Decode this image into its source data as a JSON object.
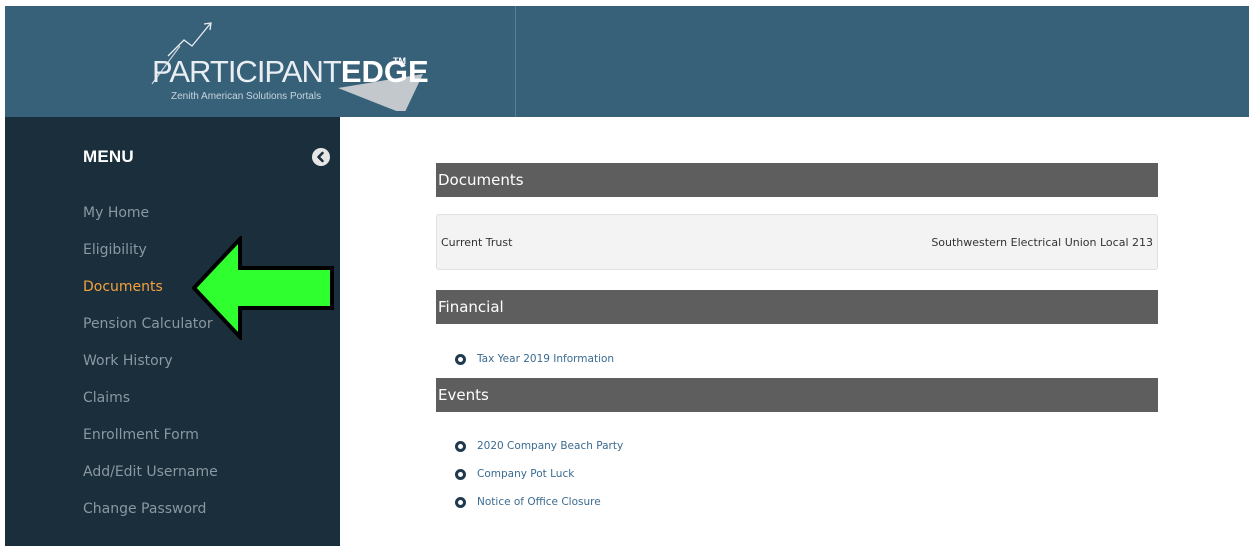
{
  "header": {
    "logo": {
      "text_light": "PARTICIPANT",
      "text_bold": "EDGE",
      "trademark": "TM",
      "subtitle": "Zenith American Solutions Portals"
    }
  },
  "sidebar": {
    "title": "MENU",
    "toggle_icon": "chevron-circle-left-icon",
    "items": [
      {
        "label": "My Home",
        "active": false
      },
      {
        "label": "Eligibility",
        "active": false
      },
      {
        "label": "Documents",
        "active": true
      },
      {
        "label": "Pension Calculator",
        "active": false
      },
      {
        "label": "Work History",
        "active": false
      },
      {
        "label": "Claims",
        "active": false
      },
      {
        "label": "Enrollment Form",
        "active": false
      },
      {
        "label": "Add/Edit Username",
        "active": false
      },
      {
        "label": "Change Password",
        "active": false
      }
    ]
  },
  "annotation": {
    "icon": "green-arrow-icon",
    "color": "#2fff2f"
  },
  "main": {
    "documents": {
      "title": "Documents",
      "trust_label": "Current Trust",
      "trust_value": "Southwestern Electrical Union Local 213"
    },
    "financial": {
      "title": "Financial",
      "links": [
        "Tax Year 2019 Information"
      ]
    },
    "events": {
      "title": "Events",
      "links": [
        "2020 Company Beach Party",
        "Company Pot Luck",
        "Notice of Office Closure"
      ]
    }
  },
  "colors": {
    "header_bg": "#376079",
    "sidebar_bg": "#1a2e3b",
    "active_item": "#f4a23c",
    "section_bar": "#5e5e5e",
    "link": "#3a6b91"
  }
}
